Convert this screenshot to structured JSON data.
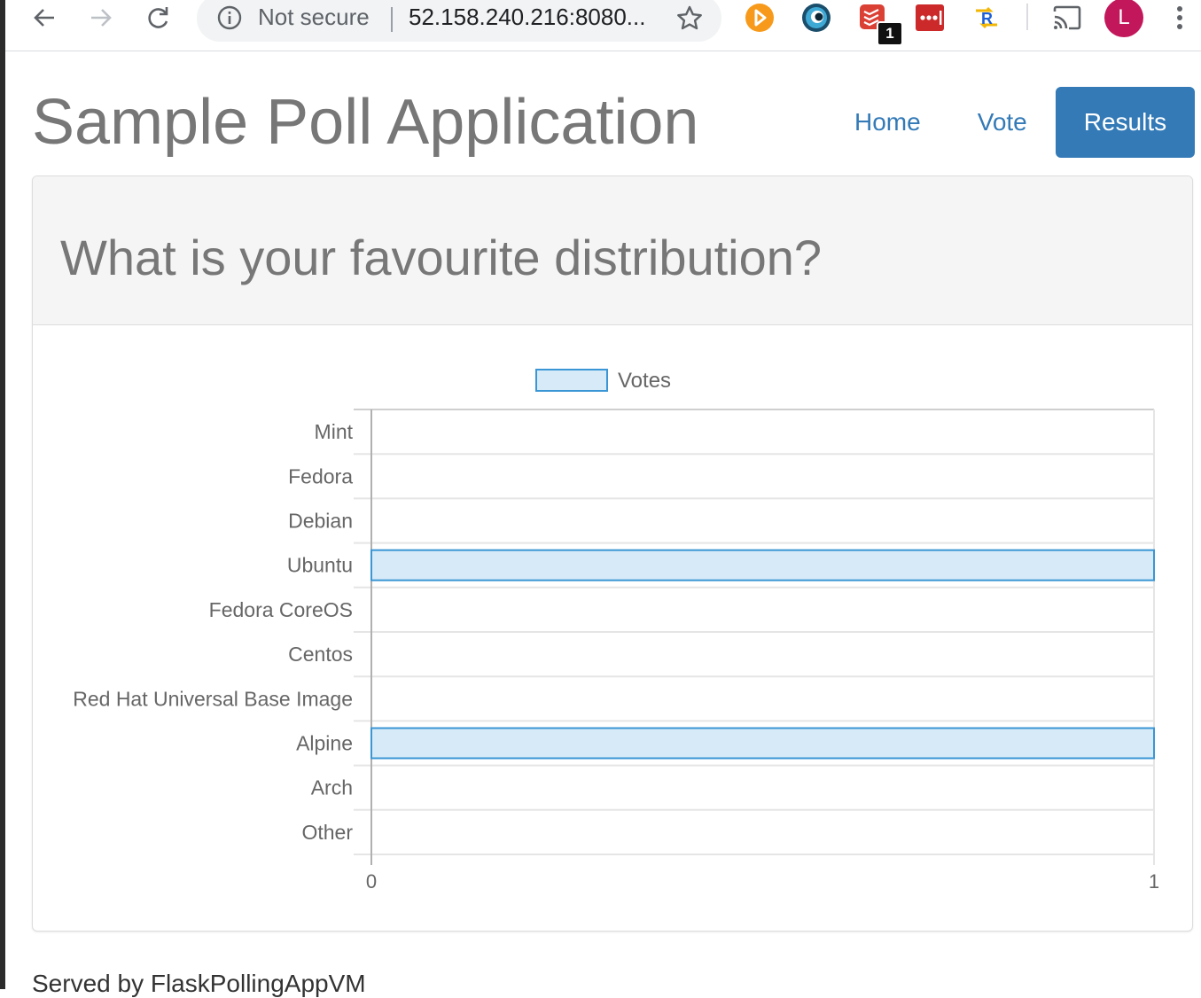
{
  "browser": {
    "security_label": "Not secure",
    "url": "52.158.240.216:8080...",
    "extension_badge": "1",
    "profile_initial": "L"
  },
  "header": {
    "title": "Sample Poll Application",
    "nav": [
      {
        "label": "Home",
        "active": false
      },
      {
        "label": "Vote",
        "active": false
      },
      {
        "label": "Results",
        "active": true
      }
    ]
  },
  "poll": {
    "question": "What is your favourite distribution?"
  },
  "chart_data": {
    "type": "bar",
    "orientation": "horizontal",
    "categories": [
      "Mint",
      "Fedora",
      "Debian",
      "Ubuntu",
      "Fedora CoreOS",
      "Centos",
      "Red Hat Universal Base Image",
      "Alpine",
      "Arch",
      "Other"
    ],
    "series": [
      {
        "name": "Votes",
        "values": [
          0,
          0,
          0,
          1,
          0,
          0,
          0,
          1,
          0,
          0
        ]
      }
    ],
    "xlim": [
      0,
      1
    ],
    "x_ticks": [
      "0",
      "1"
    ],
    "legend_position": "top",
    "grid": true,
    "colors": {
      "bar_fill": "#d6eaf8",
      "bar_stroke": "#3a96d4",
      "grid": "#e5e5e5",
      "axis": "#b0b0b0"
    }
  },
  "footer": {
    "text": "Served by FlaskPollingAppVM"
  }
}
